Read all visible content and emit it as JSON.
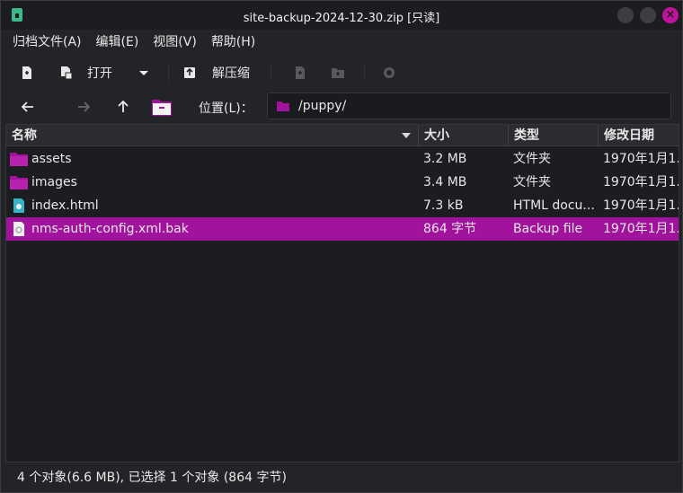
{
  "window": {
    "title": "site-backup-2024-12-30.zip [只读]",
    "accent": "#a1139c"
  },
  "menubar": [
    "归档文件(A)",
    "编辑(E)",
    "视图(V)",
    "帮助(H)"
  ],
  "toolbar": {
    "open_label": "打开",
    "extract_label": "解压缩"
  },
  "navbar": {
    "location_label": "位置(L)：",
    "location_value": "/puppy/"
  },
  "list": {
    "columns": [
      "名称",
      "大小",
      "类型",
      "修改日期"
    ],
    "rows": [
      {
        "name": "assets",
        "size": "3.2 MB",
        "type": "文件夹",
        "date": "1970年1月1...",
        "icon": "folder-icon"
      },
      {
        "name": "images",
        "size": "3.4 MB",
        "type": "文件夹",
        "date": "1970年1月1...",
        "icon": "folder-icon"
      },
      {
        "name": "index.html",
        "size": "7.3 kB",
        "type": "HTML docu...",
        "date": "1970年1月1...",
        "icon": "html-file-icon"
      },
      {
        "name": "nms-auth-config.xml.bak",
        "size": "864 字节",
        "type": "Backup file",
        "date": "1970年1月1...",
        "icon": "backup-file-icon",
        "selected": true
      }
    ]
  },
  "status": "4 个对象(6.6 MB), 已选择 1 个对象 (864 字节)"
}
